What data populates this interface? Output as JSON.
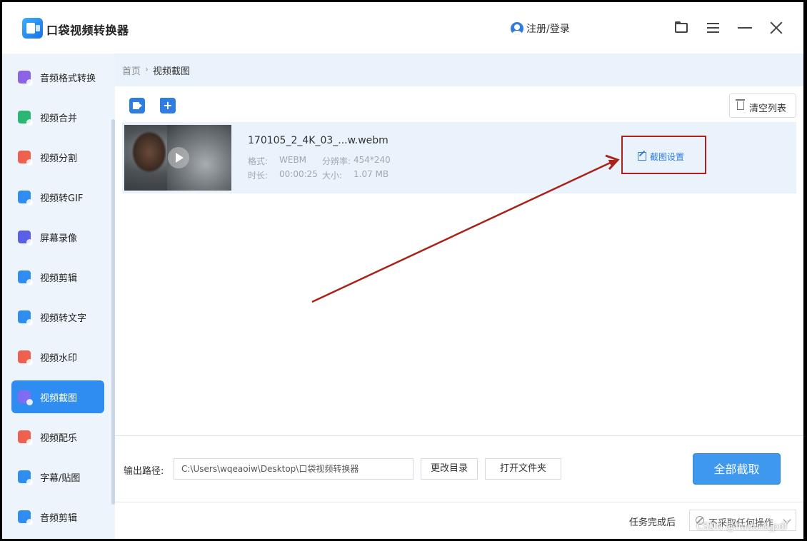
{
  "app": {
    "title": "口袋视频转换器",
    "user_label": "注册/登录"
  },
  "sidebar": {
    "items": [
      {
        "label": "音频格式转换",
        "icon": "audio-convert-icon",
        "color": "#8a63e6"
      },
      {
        "label": "视频合并",
        "icon": "video-merge-icon",
        "color": "#2bb673"
      },
      {
        "label": "视频分割",
        "icon": "video-split-icon",
        "color": "#f0604e"
      },
      {
        "label": "视频转GIF",
        "icon": "video-gif-icon",
        "color": "#2f8cf0"
      },
      {
        "label": "屏幕录像",
        "icon": "screen-record-icon",
        "color": "#5a5fe8"
      },
      {
        "label": "视频剪辑",
        "icon": "video-edit-icon",
        "color": "#2f8cf0"
      },
      {
        "label": "视频转文字",
        "icon": "video-text-icon",
        "color": "#2f8cf0"
      },
      {
        "label": "视频水印",
        "icon": "video-watermark-icon",
        "color": "#f0604e"
      },
      {
        "label": "视频截图",
        "icon": "video-screenshot-icon",
        "color": "#7f6cf0"
      },
      {
        "label": "视频配乐",
        "icon": "video-music-icon",
        "color": "#f0604e"
      },
      {
        "label": "字幕/贴图",
        "icon": "subtitle-sticker-icon",
        "color": "#2f8cf0"
      },
      {
        "label": "音频剪辑",
        "icon": "audio-edit-icon",
        "color": "#2f8cf0"
      }
    ],
    "active_label": "视频截图"
  },
  "breadcrumb": {
    "home": "首页",
    "separator": "›",
    "current": "视频截图"
  },
  "toolbar": {
    "clear_label": "清空列表"
  },
  "file": {
    "name": "170105_2_4K_03_...w.webm",
    "format_label": "格式:",
    "format_value": "WEBM",
    "resolution_label": "分辨率:",
    "resolution_value": "454*240",
    "duration_label": "时长:",
    "duration_value": "00:00:25",
    "size_label": "大小:",
    "size_value": "1.07 MB",
    "settings_label": "截图设置"
  },
  "output": {
    "label": "输出路径:",
    "path": "C:\\Users\\wqeaoiw\\Desktop\\口袋视频转换器",
    "change_dir_label": "更改目录",
    "open_folder_label": "打开文件夹",
    "capture_all_label": "全部截取"
  },
  "after_task": {
    "label": "任务完成后",
    "value": "不采取任何操作"
  },
  "watermark": "CSDN @hudunkjpdf",
  "colors": {
    "accent": "#2f8cf0",
    "highlight": "#b0201a"
  }
}
